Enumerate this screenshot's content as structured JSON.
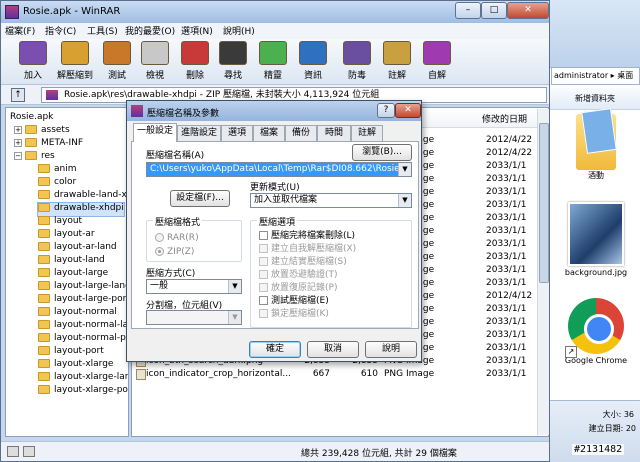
{
  "window": {
    "title": "Rosie.apk - WinRAR",
    "min": "–",
    "max": "□",
    "close": "✕"
  },
  "menu": [
    "檔案(F)",
    "指令(C)",
    "工具(S)",
    "我的最愛(O)",
    "選項(N)",
    "說明(H)"
  ],
  "toolbar": [
    {
      "label": "加入",
      "icon": "add-books-icon",
      "color": "#7a4fb0"
    },
    {
      "label": "解壓縮到",
      "icon": "extract-books-icon",
      "color": "#d8a030"
    },
    {
      "label": "測試",
      "icon": "test-icon",
      "color": "#c87828"
    },
    {
      "label": "檢視",
      "icon": "view-glasses-icon",
      "color": "#c8c8c8"
    },
    {
      "label": "刪除",
      "icon": "delete-icon",
      "color": "#c83a3a"
    },
    {
      "label": "尋找",
      "icon": "binoculars-icon",
      "color": "#3a3a3a"
    },
    {
      "label": "精靈",
      "icon": "wizard-icon",
      "color": "#4caf50"
    },
    {
      "label": "資訊",
      "icon": "info-icon",
      "color": "#3070c0"
    },
    {
      "label": "防毒",
      "icon": "virus-scan-icon",
      "color": "#6a4fa0"
    },
    {
      "label": "註解",
      "icon": "comment-icon",
      "color": "#c8a040"
    },
    {
      "label": "自解",
      "icon": "sfx-icon",
      "color": "#a03ab0"
    }
  ],
  "address": "Rosie.apk\\res\\drawable-xhdpi - ZIP 壓縮檔, 未封裝大小 4,113,924 位元組",
  "tree": {
    "root": "Rosie.apk",
    "nodes": [
      "assets",
      "META-INF",
      "res"
    ],
    "res_children": [
      "anim",
      "color",
      "drawable-land-xh",
      "drawable-xhdpi",
      "layout",
      "layout-ar",
      "layout-ar-land",
      "layout-land",
      "layout-large",
      "layout-large-land",
      "layout-large-port",
      "layout-normal",
      "layout-normal-lan",
      "layout-normal-por",
      "layout-port",
      "layout-xlarge",
      "layout-xlarge-lanc",
      "layout-xlarge-port"
    ]
  },
  "list": {
    "date_header": "修改的日期",
    "rows": [
      {
        "name": "",
        "size": "",
        "packed": "",
        "type": "PNG Image",
        "date": "2012/4/22"
      },
      {
        "name": "",
        "size": "",
        "packed": "",
        "type": "PNG Image",
        "date": "2012/4/22"
      },
      {
        "name": "",
        "size": "",
        "packed": "",
        "type": "PNG Image",
        "date": "2033/1/1"
      },
      {
        "name": "",
        "size": "",
        "packed": "",
        "type": "PNG Image",
        "date": "2033/1/1"
      },
      {
        "name": "",
        "size": "",
        "packed": "",
        "type": "PNG Image",
        "date": "2033/1/1"
      },
      {
        "name": "",
        "size": "",
        "packed": "",
        "type": "PNG Image",
        "date": "2033/1/1"
      },
      {
        "name": "",
        "size": "",
        "packed": "",
        "type": "PNG Image",
        "date": "2033/1/1"
      },
      {
        "name": "",
        "size": "",
        "packed": "",
        "type": "PNG Image",
        "date": "2033/1/1"
      },
      {
        "name": "",
        "size": "",
        "packed": "",
        "type": "PNG Image",
        "date": "2033/1/1"
      },
      {
        "name": "",
        "size": "",
        "packed": "",
        "type": "PNG Image",
        "date": "2033/1/1"
      },
      {
        "name": "",
        "size": "",
        "packed": "",
        "type": "PNG Image",
        "date": "2033/1/1"
      },
      {
        "name": "",
        "size": "",
        "packed": "",
        "type": "PNG Image",
        "date": "2033/1/1"
      },
      {
        "name": "",
        "size": "",
        "packed": "",
        "type": "PNG Image",
        "date": "2012/4/12"
      },
      {
        "name": "",
        "size": "",
        "packed": "",
        "type": "PNG Image",
        "date": "2033/1/1"
      },
      {
        "name": "icon_btn_download_dark.png",
        "size": "1,021",
        "packed": "989",
        "type": "PNG Image",
        "date": "2033/1/1"
      },
      {
        "name": "icon_btn_market_dark.png",
        "size": "3,101",
        "packed": "3,101",
        "type": "PNG Image",
        "date": "2033/1/1"
      },
      {
        "name": "icon_btn_play_store_dark.png",
        "size": "2,531",
        "packed": "2,531",
        "type": "PNG Image",
        "date": "2033/1/1"
      },
      {
        "name": "icon_btn_search_dark.png",
        "size": "2,833",
        "packed": "2,833",
        "type": "PNG Image",
        "date": "2033/1/1"
      },
      {
        "name": "icon_indicator_crop_horizontal...",
        "size": "667",
        "packed": "610",
        "type": "PNG Image",
        "date": "2033/1/1"
      }
    ]
  },
  "status": "總共 239,428 位元組, 共計 29 個檔案",
  "dialog": {
    "title": "壓縮檔名稱及參數",
    "help": "?",
    "close": "✕",
    "tabs": [
      "一般設定",
      "進階設定",
      "選項",
      "檔案",
      "備份",
      "時間",
      "註解"
    ],
    "archive_name_label": "壓縮檔名稱(A)",
    "browse_button": "瀏覽(B)...",
    "archive_name_value": "C:\\Users\\yuko\\AppData\\Local\\Temp\\Rar$DI08.662\\Rosie.apk",
    "profiles_button": "設定檔(F)...",
    "update_mode_label": "更新模式(U)",
    "update_mode_value": "加入並取代檔案",
    "format_group": "壓縮檔格式",
    "format_rar": "RAR(R)",
    "format_zip": "ZIP(Z)",
    "method_label": "壓縮方式(C)",
    "method_value": "一般",
    "split_label": "分割檔，位元組(V)",
    "options_group": "壓縮選項",
    "options": [
      {
        "label": "壓縮完將檔案刪除(L)",
        "enabled": true
      },
      {
        "label": "建立自我解壓縮檔(X)",
        "enabled": false
      },
      {
        "label": "建立結實壓縮檔(S)",
        "enabled": false
      },
      {
        "label": "放置恐避驗證(T)",
        "enabled": false
      },
      {
        "label": "放置復原記錄(P)",
        "enabled": false
      },
      {
        "label": "測試壓縮檔(E)",
        "enabled": true
      },
      {
        "label": "鎖定壓縮檔(K)",
        "enabled": false
      }
    ],
    "ok": "確定",
    "cancel": "取消",
    "help_button": "說明"
  },
  "explorer": {
    "path": "administrator ▸ 桌面",
    "new_folder": "新增資料夾",
    "folder_label": "酒動",
    "image_label": "background.jpg",
    "chrome_label": "Google Chrome",
    "size_text": "大小: 36",
    "created_text": "建立日期: 20"
  },
  "watermark": "#2131482"
}
